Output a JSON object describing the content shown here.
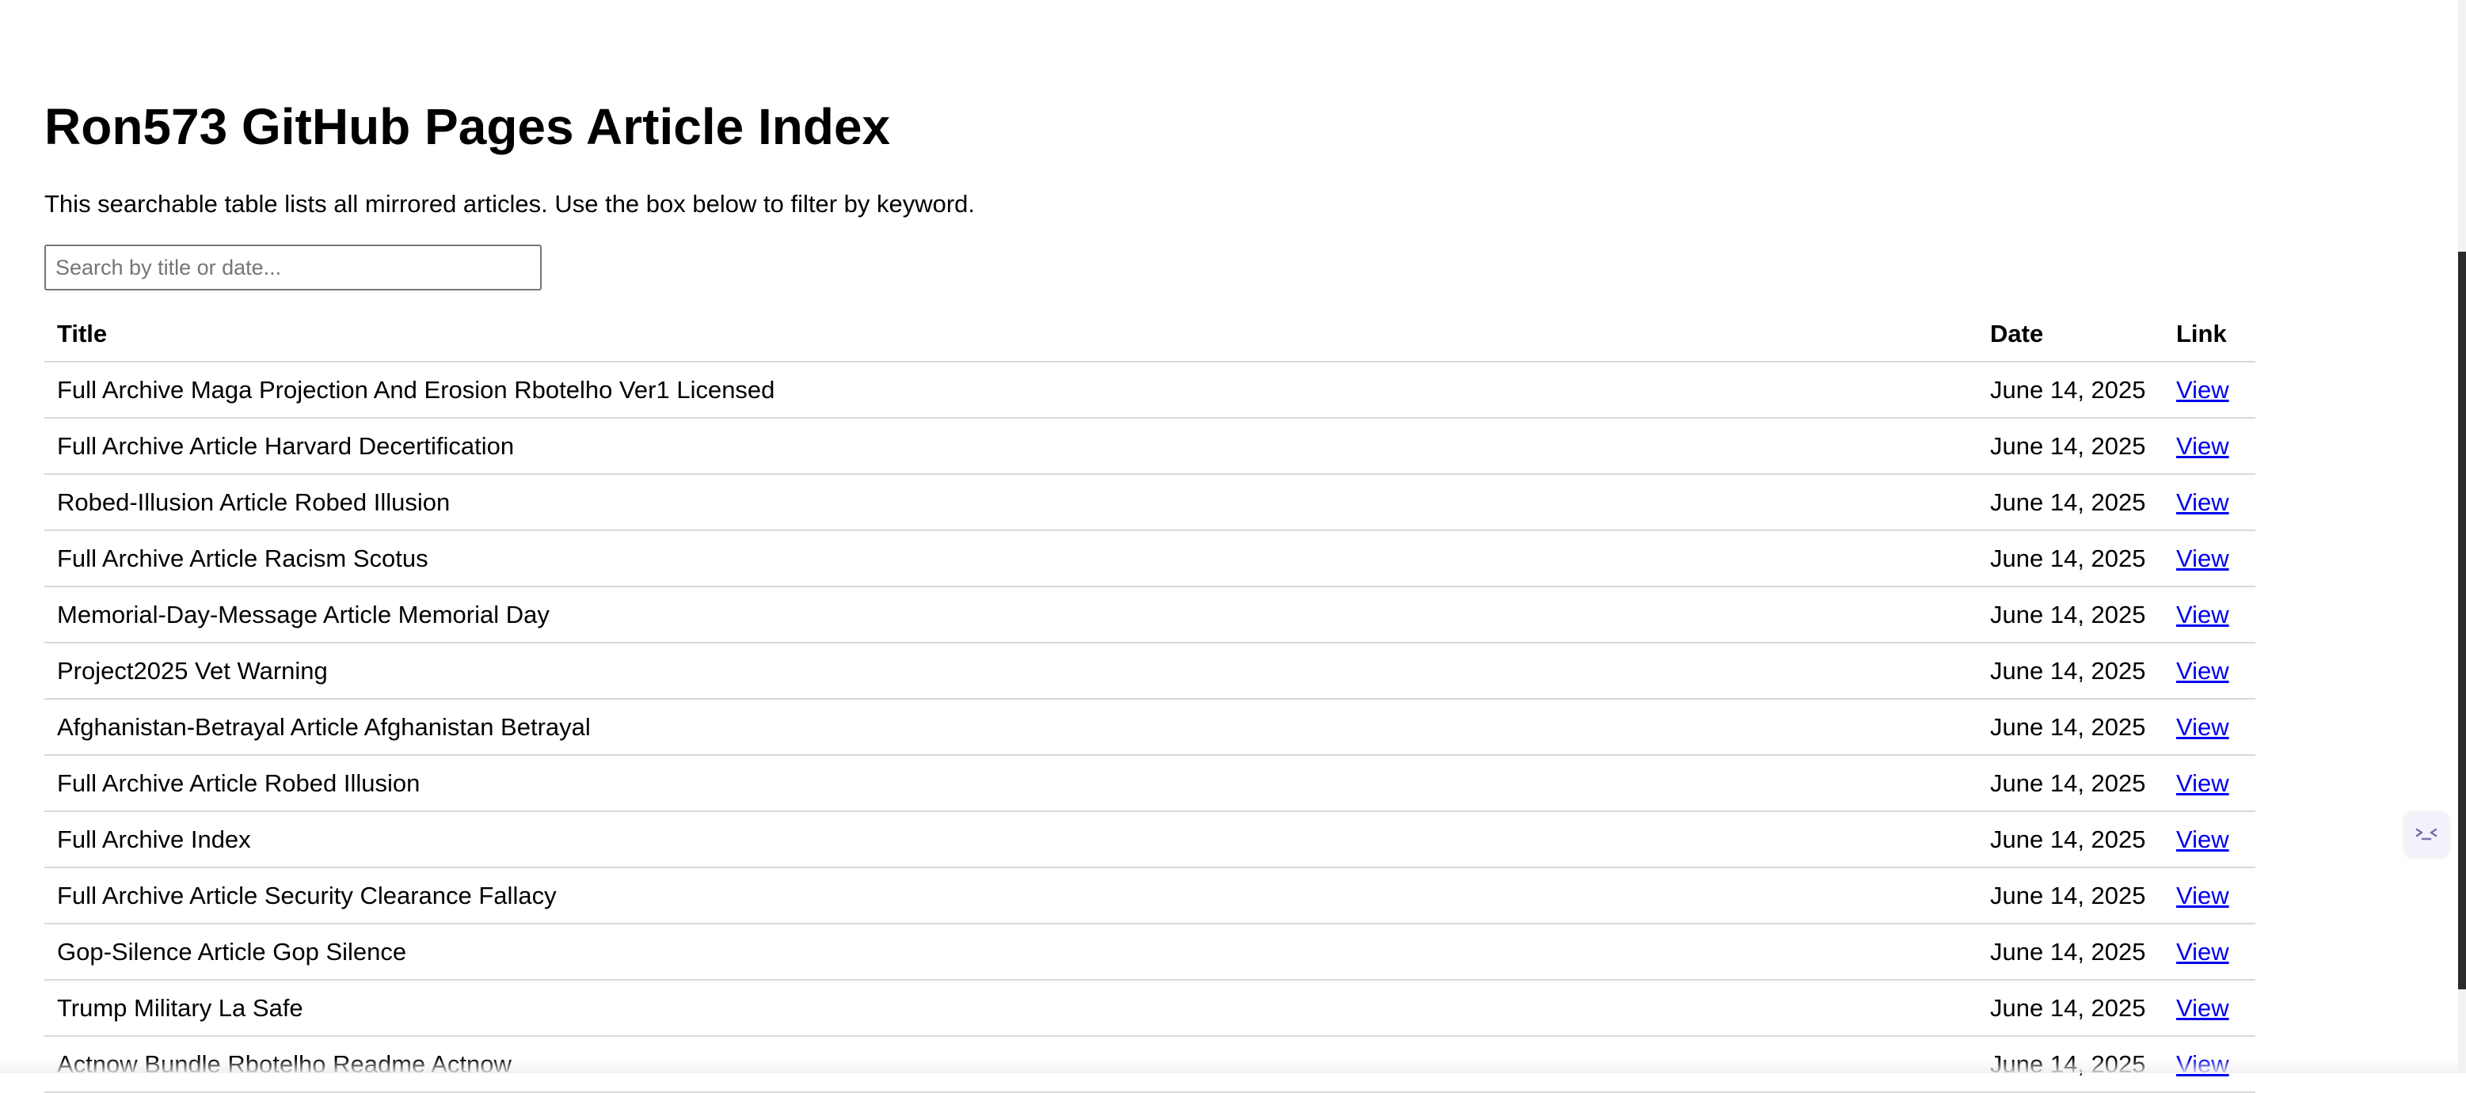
{
  "page": {
    "title": "Ron573 GitHub Pages Article Index",
    "intro": "This searchable table lists all mirrored articles. Use the box below to filter by keyword."
  },
  "search": {
    "placeholder": "Search by title or date...",
    "value": ""
  },
  "table": {
    "headers": [
      "Title",
      "Date",
      "Link"
    ],
    "rows": [
      {
        "title": "Full Archive Maga Projection And Erosion Rbotelho Ver1 Licensed",
        "date": "June 14, 2025",
        "link": "View"
      },
      {
        "title": "Full Archive Article Harvard Decertification",
        "date": "June 14, 2025",
        "link": "View"
      },
      {
        "title": "Robed-Illusion Article Robed Illusion",
        "date": "June 14, 2025",
        "link": "View"
      },
      {
        "title": "Full Archive Article Racism Scotus",
        "date": "June 14, 2025",
        "link": "View"
      },
      {
        "title": "Memorial-Day-Message Article Memorial Day",
        "date": "June 14, 2025",
        "link": "View"
      },
      {
        "title": "Project2025 Vet Warning",
        "date": "June 14, 2025",
        "link": "View"
      },
      {
        "title": "Afghanistan-Betrayal Article Afghanistan Betrayal",
        "date": "June 14, 2025",
        "link": "View"
      },
      {
        "title": "Full Archive Article Robed Illusion",
        "date": "June 14, 2025",
        "link": "View"
      },
      {
        "title": "Full Archive Index",
        "date": "June 14, 2025",
        "link": "View"
      },
      {
        "title": "Full Archive Article Security Clearance Fallacy",
        "date": "June 14, 2025",
        "link": "View"
      },
      {
        "title": "Gop-Silence Article Gop Silence",
        "date": "June 14, 2025",
        "link": "View"
      },
      {
        "title": "Trump Military La Safe",
        "date": "June 14, 2025",
        "link": "View"
      },
      {
        "title": "Actnow Bundle Rbotelho Readme Actnow",
        "date": "June 14, 2025",
        "link": "View"
      }
    ]
  },
  "colors": {
    "link": "#0000ee",
    "row_border": "#d9d9d9",
    "input_border": "#767676"
  },
  "icons": {
    "extension_widget": "extension-face-icon"
  }
}
